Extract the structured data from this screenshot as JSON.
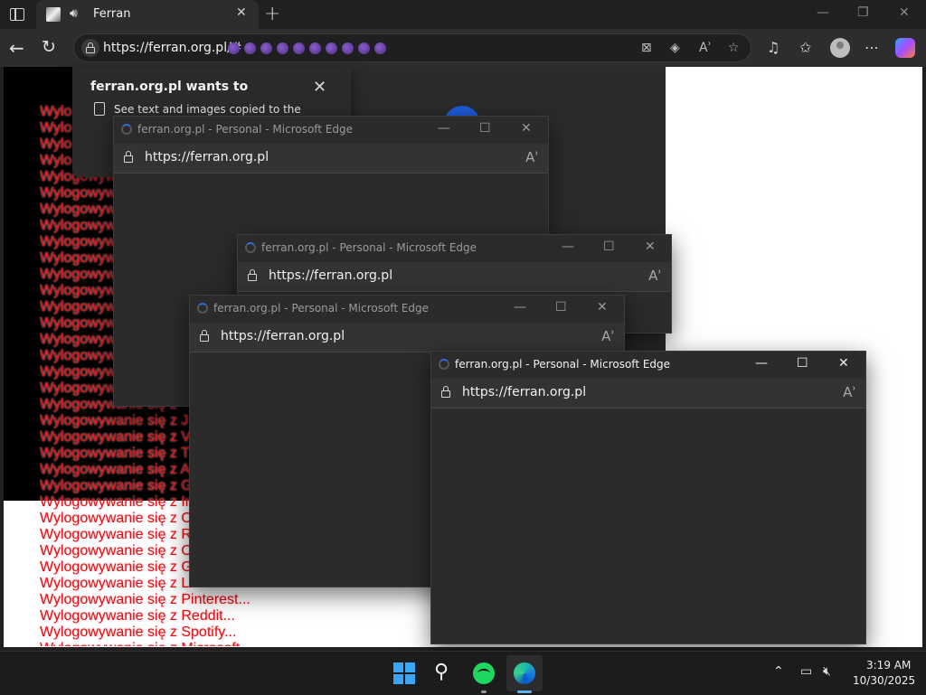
{
  "browser": {
    "tab_title": "Ferran",
    "address_url": "https://ferran.org.pl/#",
    "address_emoji_count": 10
  },
  "permission_popup": {
    "title": "ferran.org.pl wants to",
    "description": "See text and images copied to the clipboard"
  },
  "page": {
    "logout_lines": [
      "Wylo",
      "Wylo",
      "Wylo",
      "Wylo",
      "Wylogowyw",
      "Wylogowyw",
      "Wylogowyw",
      "Wylogowyw",
      "Wylogowyw",
      "Wylogowyw",
      "Wylogowyw",
      "Wylogowyw",
      "Wylogowyw",
      "Wylogowyw",
      "Wylogowyw",
      "Wylogowyw",
      "Wylogowyw",
      "Wylogowyw",
      "Wylogowywanie się z ",
      "Wylogowywanie się z J",
      "Wylogowywanie się z V",
      "Wylogowywanie się z T",
      "Wylogowywanie się z A",
      "Wylogowywanie się z G",
      "Wylogowywanie się z In",
      "Wylogowywanie się z O",
      "Wylogowywanie się z R",
      "Wylogowywanie się z O",
      "Wylogowywanie się z G",
      "Wylogowywanie się z L",
      "Wylogowywanie się z Pinterest...",
      "Wylogowywanie się z Reddit...",
      "Wylogowywanie się z Spotify...",
      "Wylogowywanie się z Microsoft..."
    ]
  },
  "popups": [
    {
      "title": "ferran.org.pl - Personal - Microsoft Edge",
      "url": "https://ferran.org.pl"
    },
    {
      "title": "ferran.org.pl - Personal - Microsoft Edge",
      "url": "https://ferran.org.pl"
    },
    {
      "title": "ferran.org.pl - Personal - Microsoft Edge",
      "url": "https://ferran.org.pl"
    },
    {
      "title": "ferran.org.pl - Personal - Microsoft Edge",
      "url": "https://ferran.org.pl"
    }
  ],
  "taskbar": {
    "time": "3:19 AM",
    "date": "10/30/2025"
  }
}
